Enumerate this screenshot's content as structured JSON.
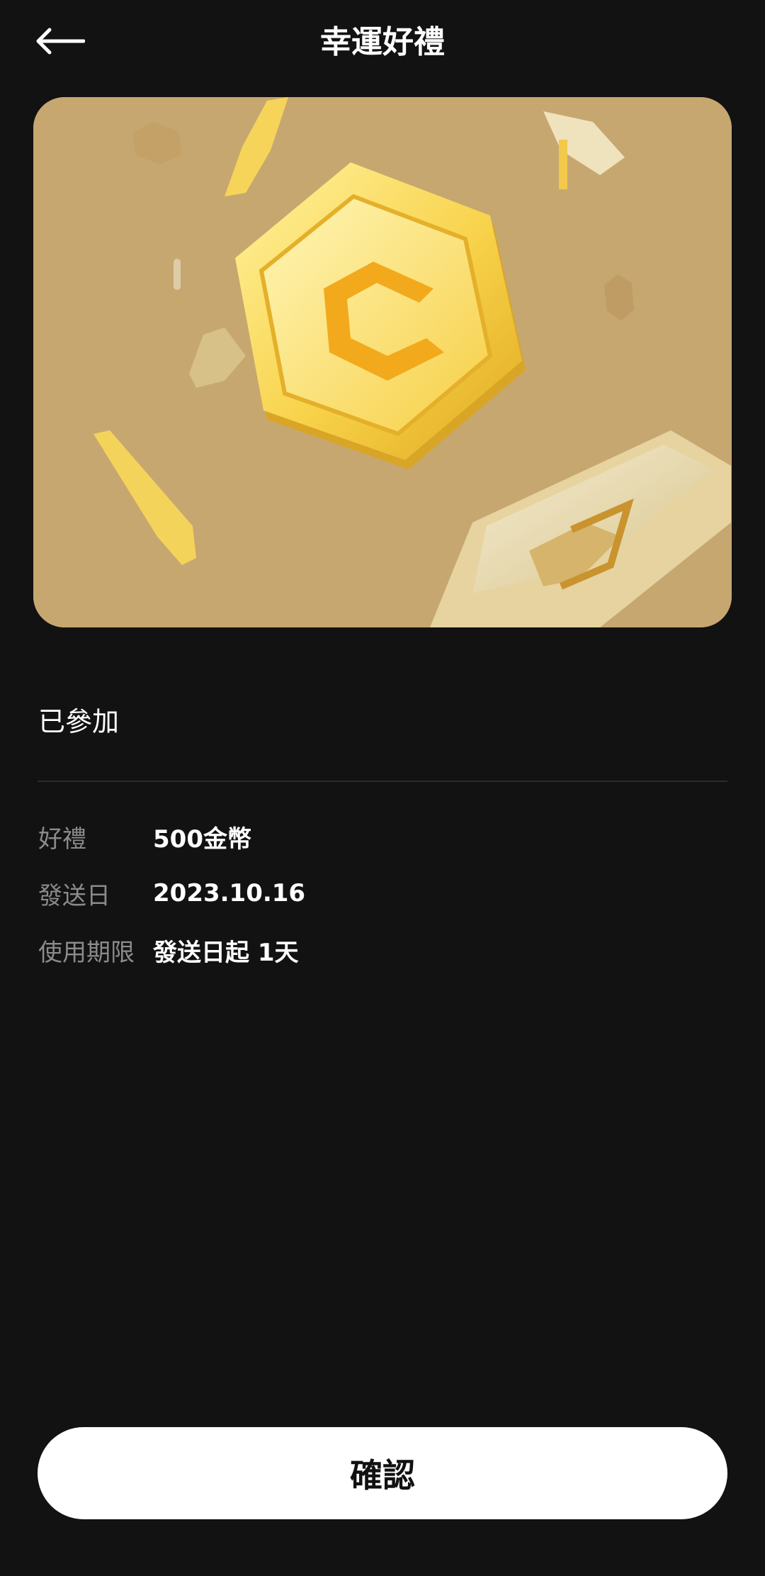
{
  "header": {
    "title": "幸運好禮",
    "back_icon": "arrow-left-icon"
  },
  "banner": {
    "image": "gold-coins-illustration",
    "background_color": "#c7a770",
    "coin_letter": "C"
  },
  "status": {
    "label": "已參加"
  },
  "details": [
    {
      "label": "好禮",
      "value": "500金幣"
    },
    {
      "label": "發送日",
      "value": "2023.10.16"
    },
    {
      "label": "使用期限",
      "value": "發送日起 1天"
    }
  ],
  "actions": {
    "confirm_label": "確認"
  }
}
